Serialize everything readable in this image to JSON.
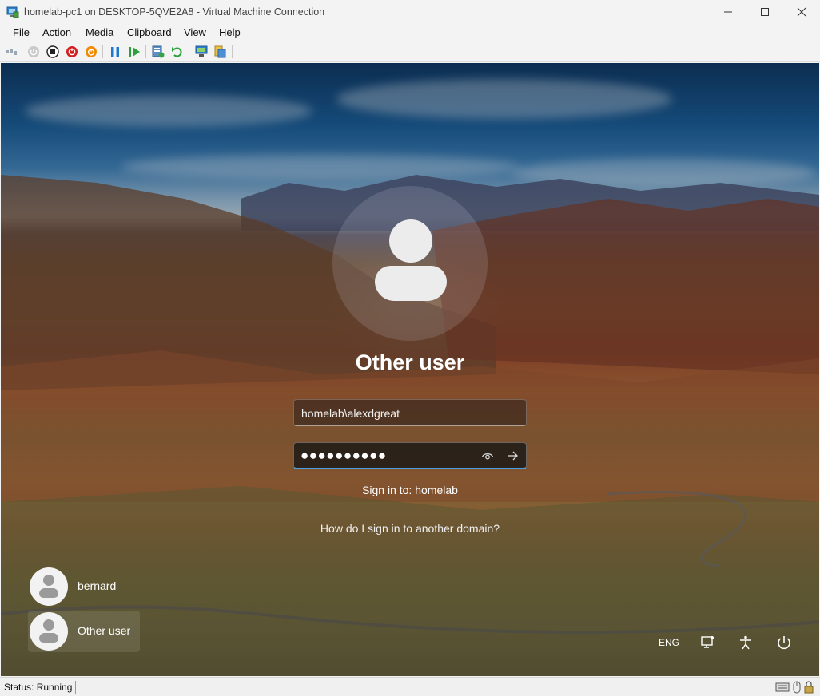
{
  "window": {
    "title": "homelab-pc1 on DESKTOP-5QVE2A8 - Virtual Machine Connection"
  },
  "menu": [
    "File",
    "Action",
    "Media",
    "Clipboard",
    "View",
    "Help"
  ],
  "toolbar": {
    "icons": [
      "ctrl-alt-del-icon",
      "start-icon",
      "turn-off-icon",
      "shut-down-icon",
      "save-icon",
      "pause-icon",
      "resume-icon",
      "checkpoint-icon",
      "revert-icon",
      "enhanced-session-icon",
      "share-icon"
    ]
  },
  "login": {
    "display_name": "Other user",
    "username_value": "homelab\\alexdgreat",
    "password_mask": "●●●●●●●●●●",
    "sign_in_to": "Sign in to: homelab",
    "help_link": "How do I sign in to another domain?",
    "users": [
      "bernard",
      "Other user"
    ],
    "language": "ENG",
    "accent_color": "#4aa0e6"
  },
  "status": {
    "text": "Status: Running"
  }
}
